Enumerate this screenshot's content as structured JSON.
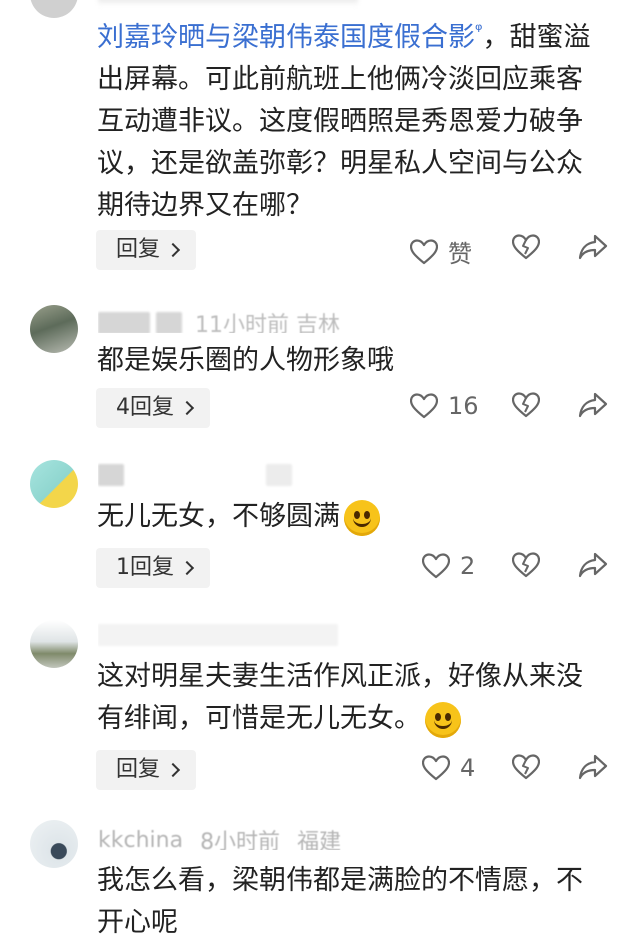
{
  "comments": [
    {
      "text_link": "刘嘉玲晒与梁朝伟泰国度假合影",
      "text_rest": "，甜蜜溢出屏幕。可此前航班上他俩冷淡回应乘客互动遭非议。这度假晒照是秀恩爱力破争议，还是欲盖弥彰？明星私人空间与公众期待边界又在哪？",
      "reply_label": "回复",
      "like_label": "赞"
    },
    {
      "meta": "吉林",
      "meta_time": "11小时前",
      "text": "都是娱乐圈的人物形象哦",
      "reply_label": "4回复",
      "like_count": "16"
    },
    {
      "text": "无儿无女，不够圆满",
      "reply_label": "1回复",
      "like_count": "2"
    },
    {
      "text": "这对明星夫妻生活作风正派，好像从来没有绯闻，可惜是无儿无女。",
      "reply_label": "回复",
      "like_count": "4"
    },
    {
      "meta_name": "kkchina",
      "meta_time": "8小时前",
      "meta_location": "福建",
      "text": "我怎么看，梁朝伟都是满脸的不情愿，不开心呢"
    }
  ],
  "icons": {
    "like": "heart-outline-icon",
    "dislike": "broken-heart-icon",
    "share": "share-arrow-icon",
    "emoji": "smile-emoji-icon",
    "search": "search-icon"
  },
  "colors": {
    "link": "#3a6fd1",
    "text": "#222222",
    "muted": "#9a9a9a",
    "button_bg": "#f2f2f2",
    "emoji": "#f7c31a"
  }
}
